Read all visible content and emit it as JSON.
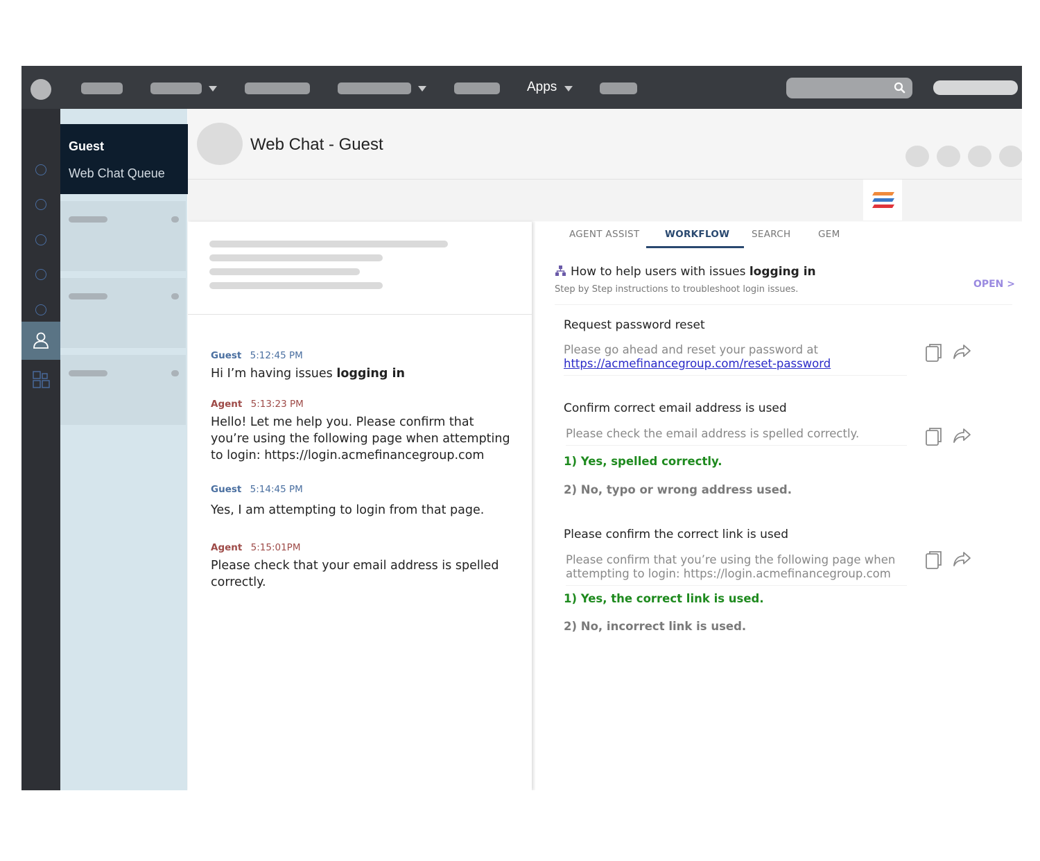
{
  "topnav": {
    "apps_label": "Apps"
  },
  "queue": {
    "active_name": "Guest",
    "active_queue": "Web Chat Queue"
  },
  "header": {
    "title": "Web Chat - Guest"
  },
  "chat": {
    "messages": [
      {
        "who": "Guest",
        "time": "5:12:45 PM",
        "text_before": "Hi I’m having issues ",
        "text_bold": "logging in"
      },
      {
        "who": "Agent",
        "time": "5:13:23 PM",
        "text": "Hello! Let me help you. Please confirm that you’re using the following page when attempting to login: https://login.acmefinancegroup.com"
      },
      {
        "who": "Guest",
        "time": "5:14:45 PM",
        "text": "Yes, I am attempting to login from that page."
      },
      {
        "who": "Agent",
        "time": "5:15:01PM",
        "text": "Please check that your email address is spelled correctly."
      }
    ]
  },
  "assist": {
    "tabs": [
      "AGENT ASSIST",
      "WORKFLOW",
      "SEARCH",
      "GEM"
    ],
    "active_tab": "WORKFLOW",
    "workflow": {
      "title_before": "How to help users with issues ",
      "title_bold": "logging in",
      "subtitle": "Step by Step instructions to troubleshoot login issues.",
      "open_label": "OPEN >",
      "steps": [
        {
          "title": "Request password reset",
          "text": "Please go ahead and reset your password at",
          "link": "https://acmefinancegroup.com/reset-password"
        },
        {
          "title": "Confirm correct email address is used",
          "text": "Please check the email address is spelled correctly.",
          "option_yes": "1) Yes, spelled correctly.",
          "option_no": "2) No, typo or wrong address used."
        },
        {
          "title": "Please confirm the correct link is used",
          "text": "Please confirm that you’re using the following page when attempting to login: https://login.acmefinancegroup.com",
          "option_yes": "1) Yes, the correct link is used.",
          "option_no": "2) No, incorrect link is used."
        }
      ]
    }
  },
  "colors": {
    "nav_bg": "#383b40",
    "rail_bg": "#2e3035",
    "queue_bg": "#d6e5ec",
    "queue_active_bg": "#0d1d2d",
    "guest_color": "#4a6fa0",
    "agent_color": "#9e4b48",
    "tab_active": "#29486f",
    "option_yes": "#1e8a1e",
    "open_link": "#9a8ae0"
  },
  "icons": [
    "search-icon",
    "caret-down-icon",
    "user-icon",
    "apps-icon",
    "workflow-icon",
    "copy-icon",
    "share-icon",
    "brand-logo-icon"
  ]
}
